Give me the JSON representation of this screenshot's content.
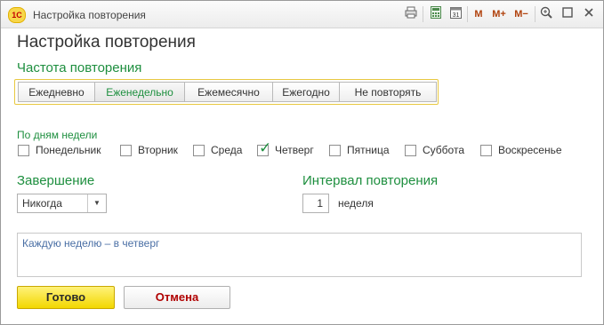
{
  "window": {
    "logo_text": "1С",
    "title": "Настройка повторения",
    "toolbar": {
      "mem_m": "M",
      "mem_mplus": "M+",
      "mem_mminus": "M−"
    }
  },
  "form": {
    "heading": "Настройка повторения",
    "frequency": {
      "title": "Частота повторения",
      "options": [
        "Ежедневно",
        "Еженедельно",
        "Ежемесячно",
        "Ежегодно",
        "Не повторять"
      ],
      "selected": "Еженедельно"
    },
    "days": {
      "title": "По дням недели",
      "items": [
        {
          "label": "Понедельник",
          "checked": false
        },
        {
          "label": "Вторник",
          "checked": false
        },
        {
          "label": "Среда",
          "checked": false
        },
        {
          "label": "Четверг",
          "checked": true
        },
        {
          "label": "Пятница",
          "checked": false
        },
        {
          "label": "Суббота",
          "checked": false
        },
        {
          "label": "Воскресенье",
          "checked": false
        }
      ]
    },
    "ending": {
      "title": "Завершение",
      "value": "Никогда"
    },
    "interval": {
      "title": "Интервал повторения",
      "value": "1",
      "unit": "неделя"
    },
    "summary": "Каждую неделю – в четверг",
    "buttons": {
      "ok": "Готово",
      "cancel": "Отмена"
    }
  },
  "colors": {
    "accent_green": "#1e8f3f",
    "ok_button": "#f2d700",
    "cancel_text": "#b00000"
  }
}
